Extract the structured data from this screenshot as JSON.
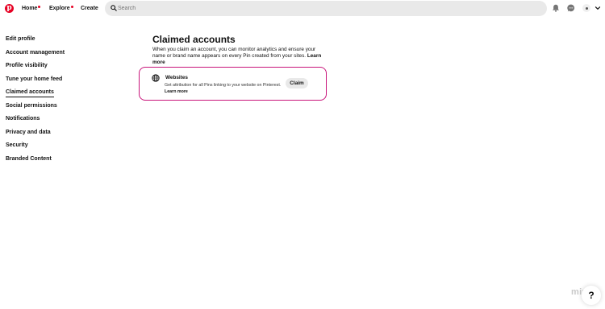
{
  "header": {
    "logo_letter": "p",
    "nav": [
      {
        "label": "Home",
        "dot": true
      },
      {
        "label": "Explore",
        "dot": true
      },
      {
        "label": "Create",
        "dot": false
      }
    ],
    "search": {
      "placeholder": "Search"
    }
  },
  "sidebar": {
    "items": [
      {
        "label": "Edit profile"
      },
      {
        "label": "Account management"
      },
      {
        "label": "Profile visibility"
      },
      {
        "label": "Tune your home feed"
      },
      {
        "label": "Claimed accounts",
        "active": true
      },
      {
        "label": "Social permissions"
      },
      {
        "label": "Notifications"
      },
      {
        "label": "Privacy and data"
      },
      {
        "label": "Security"
      },
      {
        "label": "Branded Content"
      }
    ]
  },
  "main": {
    "title": "Claimed accounts",
    "description": "When you claim an account, you can monitor analytics and ensure your name or brand name appears on every Pin created from your sites.",
    "description_link": "Learn more",
    "card": {
      "title": "Websites",
      "description": "Get attribution for all Pins linking to your website on Pinterest.",
      "link": "Learn more",
      "button": "Claim"
    }
  },
  "help": {
    "label": "?"
  },
  "watermark": "miro",
  "colors": {
    "brand": "#e60023",
    "highlight_border": "#c8147a",
    "button_bg": "#e9e9e9"
  }
}
